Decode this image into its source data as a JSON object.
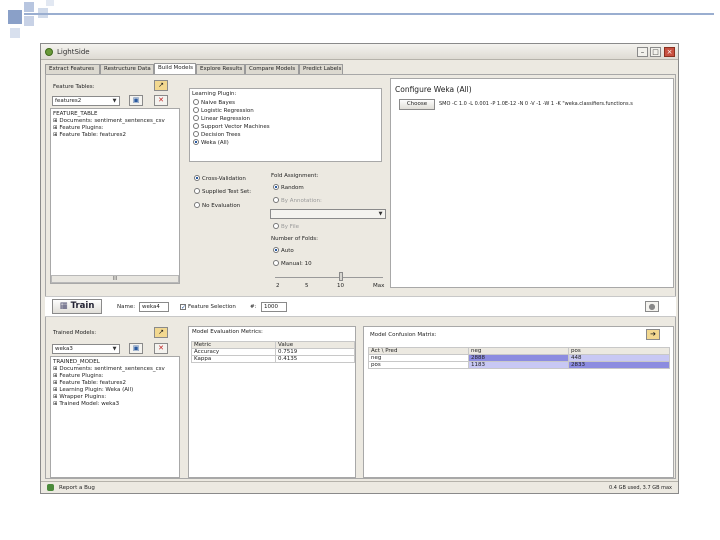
{
  "window": {
    "title": "LightSide"
  },
  "tabs": [
    "Extract Features",
    "Restructure Data",
    "Build Models",
    "Explore Results",
    "Compare Models",
    "Predict Labels"
  ],
  "active_tab_index": 2,
  "feature_tables": {
    "label": "Feature Tables:",
    "selected": "features2",
    "tree": [
      "FEATURE_TABLE",
      "Documents: sentiment_sentences_csv",
      "Feature Plugins:",
      "Feature Table: features2"
    ],
    "scroll_label": "III"
  },
  "learning_plugin": {
    "label": "Learning Plugin:",
    "options": [
      "Naive Bayes",
      "Logistic Regression",
      "Linear Regression",
      "Support Vector Machines",
      "Decision Trees",
      "Weka (All)"
    ],
    "selected_index": 5
  },
  "evaluation": {
    "options": [
      "Cross-Validation",
      "Supplied Test Set:",
      "No Evaluation"
    ],
    "selected_index": 0
  },
  "fold_assignment": {
    "label": "Fold Assignment:",
    "random": "Random",
    "by_annotation": "By Annotation:",
    "by_file": "By File"
  },
  "num_folds": {
    "label": "Number of Folds:",
    "auto": "Auto",
    "manual": "Manual: 10",
    "ticks": [
      "2",
      "5",
      "10",
      "Max"
    ]
  },
  "configure": {
    "title": "Configure Weka (All)",
    "choose_label": "Choose",
    "classifier": "SMO -C 1.0 -L 0.001 -P 1.0E-12 -N 0 -V -1 -W 1 -K \"weka.classifiers.functions.s"
  },
  "train_bar": {
    "button": "Train",
    "name_label": "Name:",
    "name_value": "weka4",
    "feature_selection": "Feature Selection",
    "num_label": "#:",
    "num_value": "1000"
  },
  "trained_models": {
    "label": "Trained Models:",
    "selected": "weka3",
    "tree": [
      "TRAINED_MODEL",
      "Documents: sentiment_sentences_csv",
      "Feature Plugins:",
      "Feature Table: features2",
      "Learning Plugin: Weka (All)",
      "Wrapper Plugins:",
      "Trained Model: weka3"
    ]
  },
  "eval_metrics": {
    "label": "Model Evaluation Metrics:",
    "headers": [
      "Metric",
      "Value"
    ],
    "rows": [
      [
        "Accuracy",
        "0.7519"
      ],
      [
        "Kappa",
        "0.4135"
      ]
    ]
  },
  "confusion": {
    "label": "Model Confusion Matrix:",
    "headers": [
      "Act \\ Pred",
      "neg",
      "pos"
    ],
    "rows": [
      [
        "neg",
        "2888",
        "448"
      ],
      [
        "pos",
        "1183",
        "2833"
      ]
    ]
  },
  "status": {
    "report_bug": "Report a Bug",
    "memory": "0.4 GB used, 3.7 GB max"
  }
}
